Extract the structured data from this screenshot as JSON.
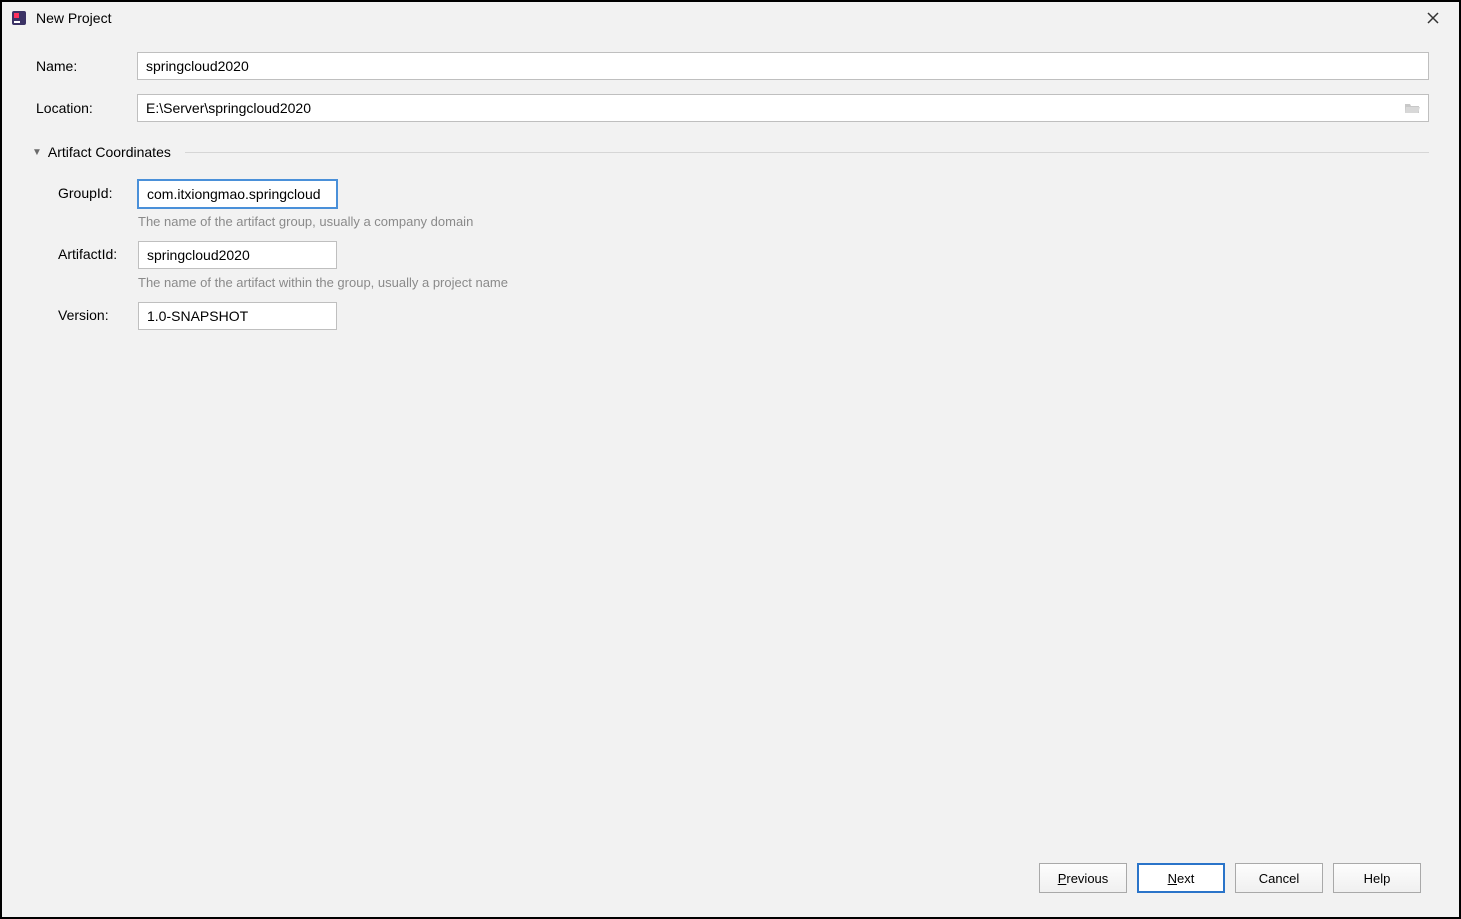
{
  "window": {
    "title": "New Project"
  },
  "form": {
    "name_label": "Name:",
    "name_value": "springcloud2020",
    "location_label": "Location:",
    "location_value": "E:\\Server\\springcloud2020"
  },
  "artifact_section": {
    "title": "Artifact Coordinates",
    "groupid_label": "GroupId:",
    "groupid_value": "com.itxiongmao.springcloud",
    "groupid_hint": "The name of the artifact group, usually a company domain",
    "artifactid_label": "ArtifactId:",
    "artifactid_value": "springcloud2020",
    "artifactid_hint": "The name of the artifact within the group, usually a project name",
    "version_label": "Version:",
    "version_value": "1.0-SNAPSHOT"
  },
  "buttons": {
    "previous": "Previous",
    "next": "Next",
    "cancel": "Cancel",
    "help": "Help"
  }
}
